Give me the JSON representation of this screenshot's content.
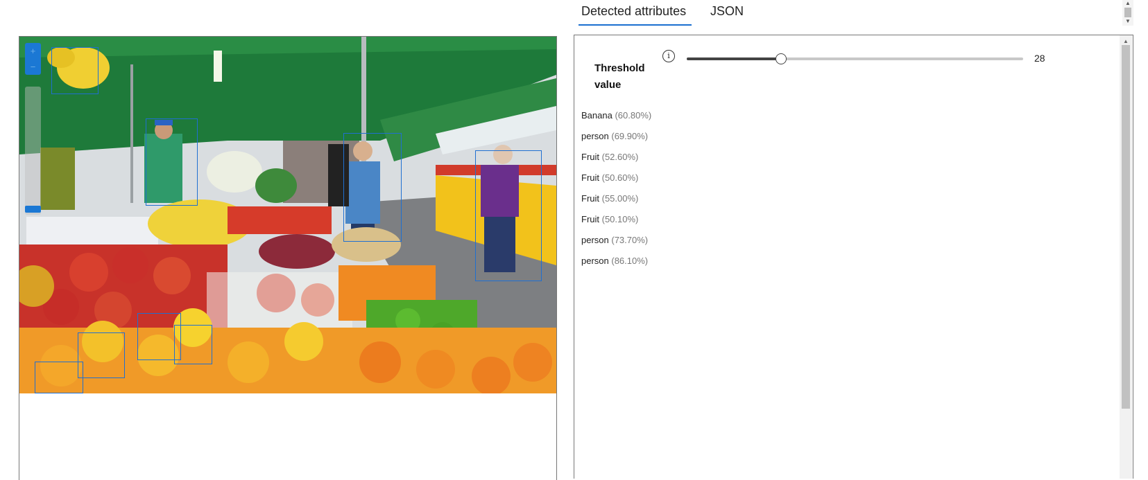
{
  "tabs": [
    {
      "label": "Detected attributes",
      "active": true
    },
    {
      "label": "JSON",
      "active": false
    }
  ],
  "image_panel": {
    "zoom_in_icon": "plus-icon",
    "zoom_out_icon": "minus-icon",
    "zoom_level": 0.9,
    "detections": [
      {
        "name": "bbox-banana"
      },
      {
        "name": "bbox-person-1"
      },
      {
        "name": "bbox-fruit-1"
      },
      {
        "name": "bbox-fruit-2"
      },
      {
        "name": "bbox-fruit-3"
      },
      {
        "name": "bbox-fruit-4"
      },
      {
        "name": "bbox-person-2"
      },
      {
        "name": "bbox-person-3"
      }
    ],
    "box_color": "#1f6fd1"
  },
  "threshold": {
    "label": "Threshold value",
    "info_icon": "info-icon",
    "value": "28",
    "fraction": 0.28
  },
  "attributes": [
    {
      "name": "Banana",
      "confidence": "(60.80%)"
    },
    {
      "name": "person",
      "confidence": "(69.90%)"
    },
    {
      "name": "Fruit",
      "confidence": "(52.60%)"
    },
    {
      "name": "Fruit",
      "confidence": "(50.60%)"
    },
    {
      "name": "Fruit",
      "confidence": "(55.00%)"
    },
    {
      "name": "Fruit",
      "confidence": "(50.10%)"
    },
    {
      "name": "person",
      "confidence": "(73.70%)"
    },
    {
      "name": "person",
      "confidence": "(86.10%)"
    }
  ],
  "colors": {
    "accent": "#1a6fd0",
    "slider": "#444444"
  }
}
